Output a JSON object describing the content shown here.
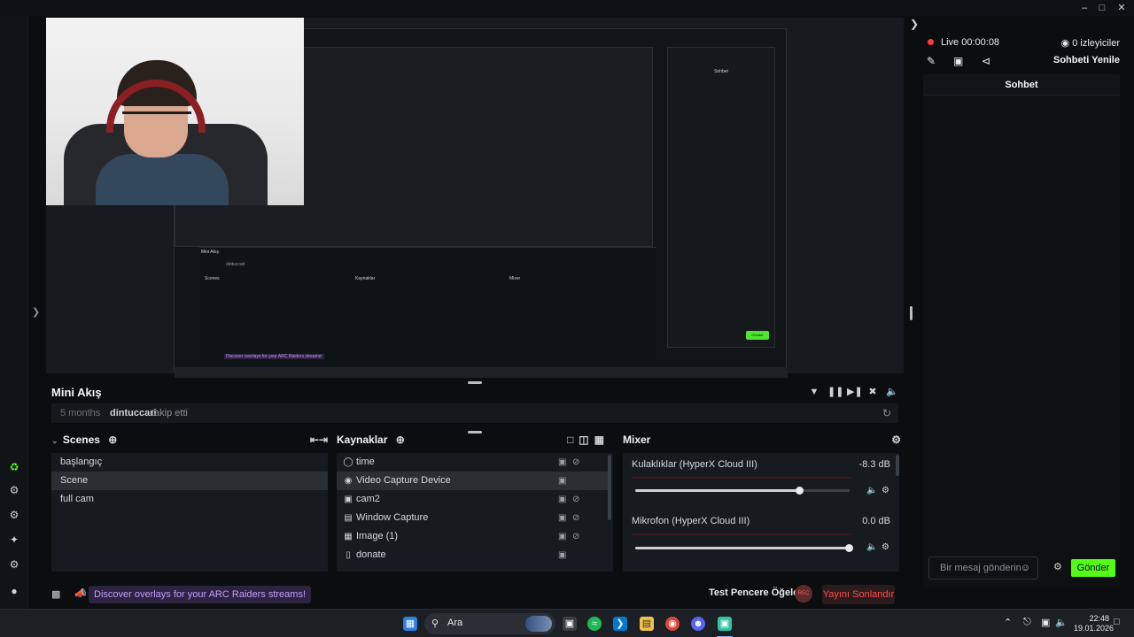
{
  "preview": {
    "nested_promo": "Discover overlays for your ARC Raiders streams!",
    "nested_mini_feed": "Mini Akış",
    "nested_feed_user": "dintuccari",
    "nested_scenes": "Scenes",
    "nested_sources": "Kaynaklar",
    "nested_mixer": "Mixer",
    "nested_chat": "Sohbet",
    "nested_send": "Gönder"
  },
  "mini_feed": {
    "title": "Mini Akış",
    "time": "5 months",
    "user": "dintuccari",
    "action": "takip etti"
  },
  "scenes": {
    "title": "Scenes",
    "items": [
      {
        "label": "başlangıç"
      },
      {
        "label": "Scene"
      },
      {
        "label": "full cam"
      }
    ],
    "active_index": 1
  },
  "sources": {
    "title": "Kaynaklar",
    "items": [
      {
        "label": "time",
        "icon": "globe-icon"
      },
      {
        "label": "Video Capture Device",
        "icon": "webcam-icon"
      },
      {
        "label": "cam2",
        "icon": "camera-icon"
      },
      {
        "label": "Window Capture",
        "icon": "window-icon"
      },
      {
        "label": "Image (1)",
        "icon": "image-icon"
      },
      {
        "label": "donate",
        "icon": "text-icon"
      }
    ],
    "active_index": 1
  },
  "mixer": {
    "title": "Mixer",
    "channels": [
      {
        "name": "Kulaklıklar (HyperX Cloud III)",
        "db": "-8.3 dB",
        "level": 0.77
      },
      {
        "name": "Mikrofon (HyperX Cloud III)",
        "db": "0.0 dB",
        "level": 1.0
      }
    ]
  },
  "statusbar": {
    "promo": "Discover overlays for your ARC Raiders streams!",
    "test_widgets": "Test Pencere Öğeleri",
    "rec": "REC",
    "end_stream": "Yayını Sonlandır"
  },
  "right_panel": {
    "live": "Live 00:00:08",
    "viewers": "0 izleyiciler",
    "refresh_chat": "Sohbeti Yenile",
    "chat_title": "Sohbet",
    "input_placeholder": "Bir mesaj gönderin",
    "send": "Gönder"
  },
  "taskbar": {
    "search": "Ara",
    "time": "22:48",
    "date": "19.01.2026"
  },
  "colors": {
    "accent": "#53fc18",
    "live": "#ff3b3b",
    "end_stream": "#ff5050",
    "promo": "#c79cff"
  }
}
